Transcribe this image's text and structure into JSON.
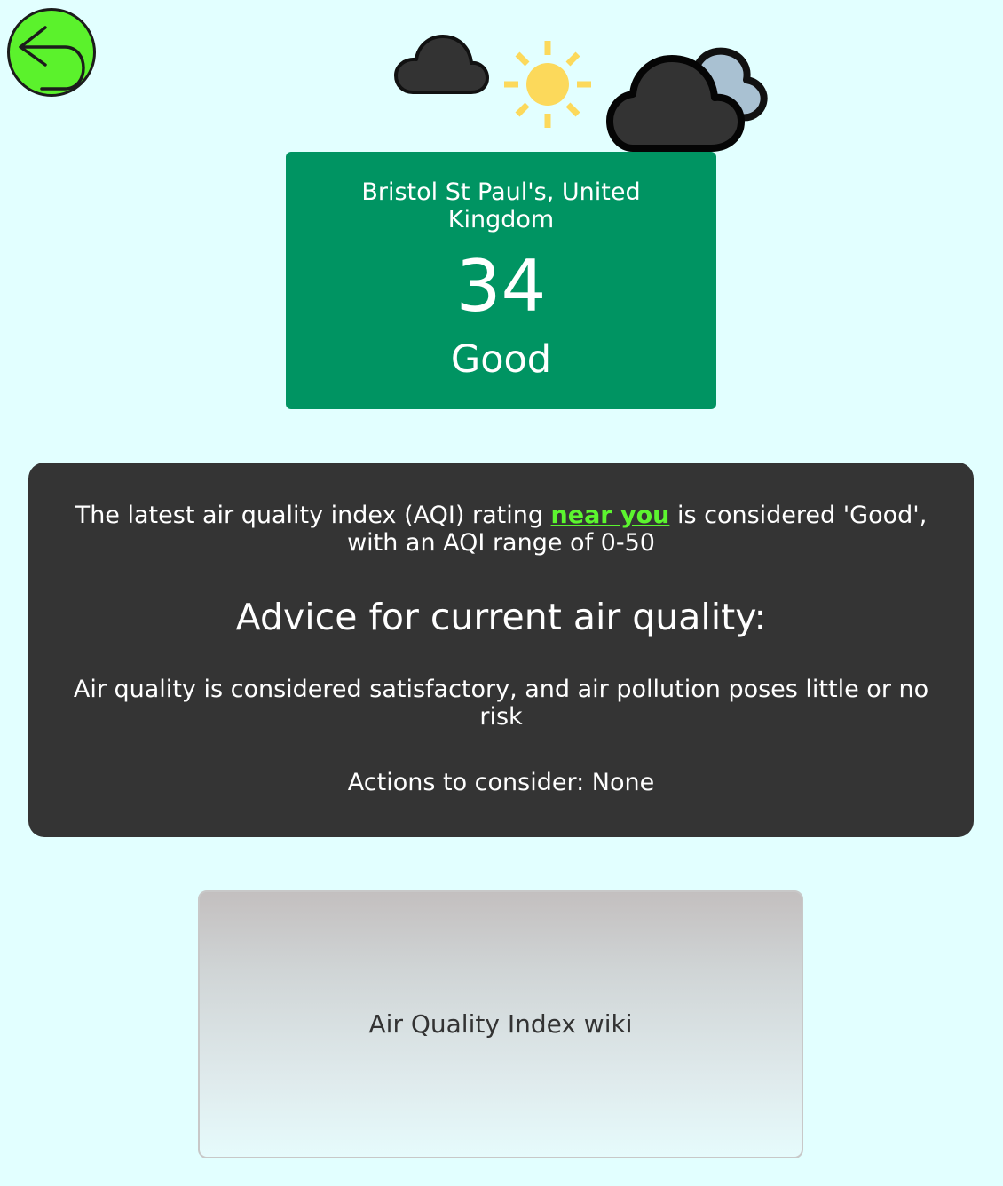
{
  "nav": {
    "back_icon": "back-arrow-icon",
    "back_color": "#5bf22c"
  },
  "weather_icons": [
    "cloud-icon",
    "sun-icon",
    "cloud-with-moon-icon"
  ],
  "aqi_card": {
    "location": "Bristol St Paul's, United Kingdom",
    "value": "34",
    "rating": "Good",
    "color": "#009462"
  },
  "advice": {
    "summary_before": "The latest air quality index (AQI) rating ",
    "near_you_link": "near you",
    "summary_after": " is considered 'Good', with an AQI range of 0-50",
    "heading": "Advice for current air quality:",
    "text": "Air quality is considered satisfactory, and air pollution poses little or no risk",
    "actions": "Actions to consider: None",
    "link_color": "#5cf52f"
  },
  "wiki_button": {
    "label": "Air Quality Index wiki"
  }
}
